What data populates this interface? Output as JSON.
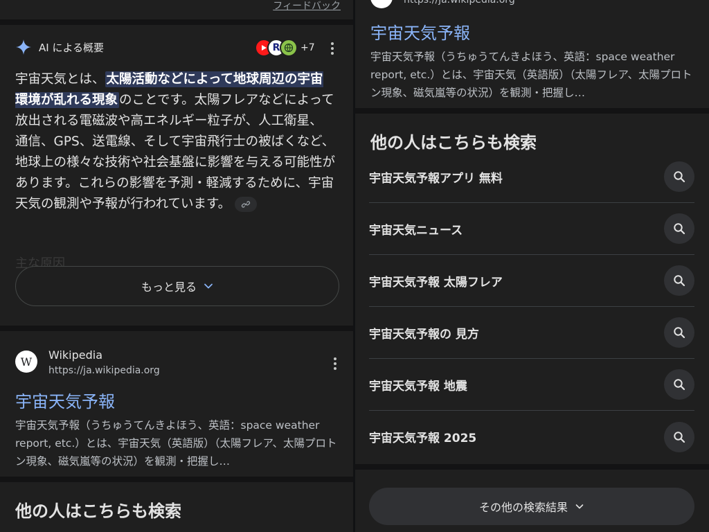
{
  "left": {
    "feedback_label": "フィードバック",
    "ai_overview": {
      "title": "AI による概要",
      "sources_more": "+7",
      "source_icons": [
        "youtube-icon",
        "r-logo-icon",
        "globe-logo-icon"
      ],
      "text_before": "宇宙天気とは、",
      "text_highlight": "太陽活動などによって地球周辺の宇宙環境が乱れる現象",
      "text_after": "のことです。太陽フレアなどによって放出される電磁波や高エネルギー粒子が、人工衛星、通信、GPS、送電線、そして宇宙飛行士の被ばくなど、地球上の様々な技術や社会基盤に影響を与える可能性があります。これらの影響を予測・軽減するために、宇宙天気の観測や予報が行われています。",
      "faded_heading": "主な原因",
      "show_more_label": "もっと見る"
    },
    "result": {
      "favicon_letter": "W",
      "site_name": "Wikipedia",
      "url": "https://ja.wikipedia.org",
      "title": "宇宙天気予報",
      "snippet": "宇宙天気予報（うちゅうてんきよほう、英語：space weather report, etc.）とは、宇宙天気（英語版）（太陽フレア、太陽プロトン現象、磁気嵐等の状況）を観測・把握し…"
    },
    "people_also_search": "他の人はこちらも検索"
  },
  "right": {
    "result": {
      "url": "https://ja.wikipedia.org",
      "title": "宇宙天気予報",
      "snippet": "宇宙天気予報（うちゅうてんきよほう、英語：space weather report, etc.）とは、宇宙天気（英語版）（太陽フレア、太陽プロトン現象、磁気嵐等の状況）を観測・把握し…"
    },
    "people_also_search": "他の人はこちらも検索",
    "related_searches": [
      {
        "query": "宇宙天気予報アプリ 無料"
      },
      {
        "query": "宇宙天気ニュース"
      },
      {
        "query": "宇宙天気予報 太陽フレア"
      },
      {
        "query": "宇宙天気予報の 見方"
      },
      {
        "query": "宇宙天気予報 地震"
      },
      {
        "query": "宇宙天気予報 2025"
      }
    ],
    "more_results_label": "その他の検索結果"
  },
  "colors": {
    "background": "#1f1f1f",
    "link": "#8ab4f8",
    "highlight": "#2f3a5a",
    "accent_sparkle": "#8ab4f8"
  }
}
